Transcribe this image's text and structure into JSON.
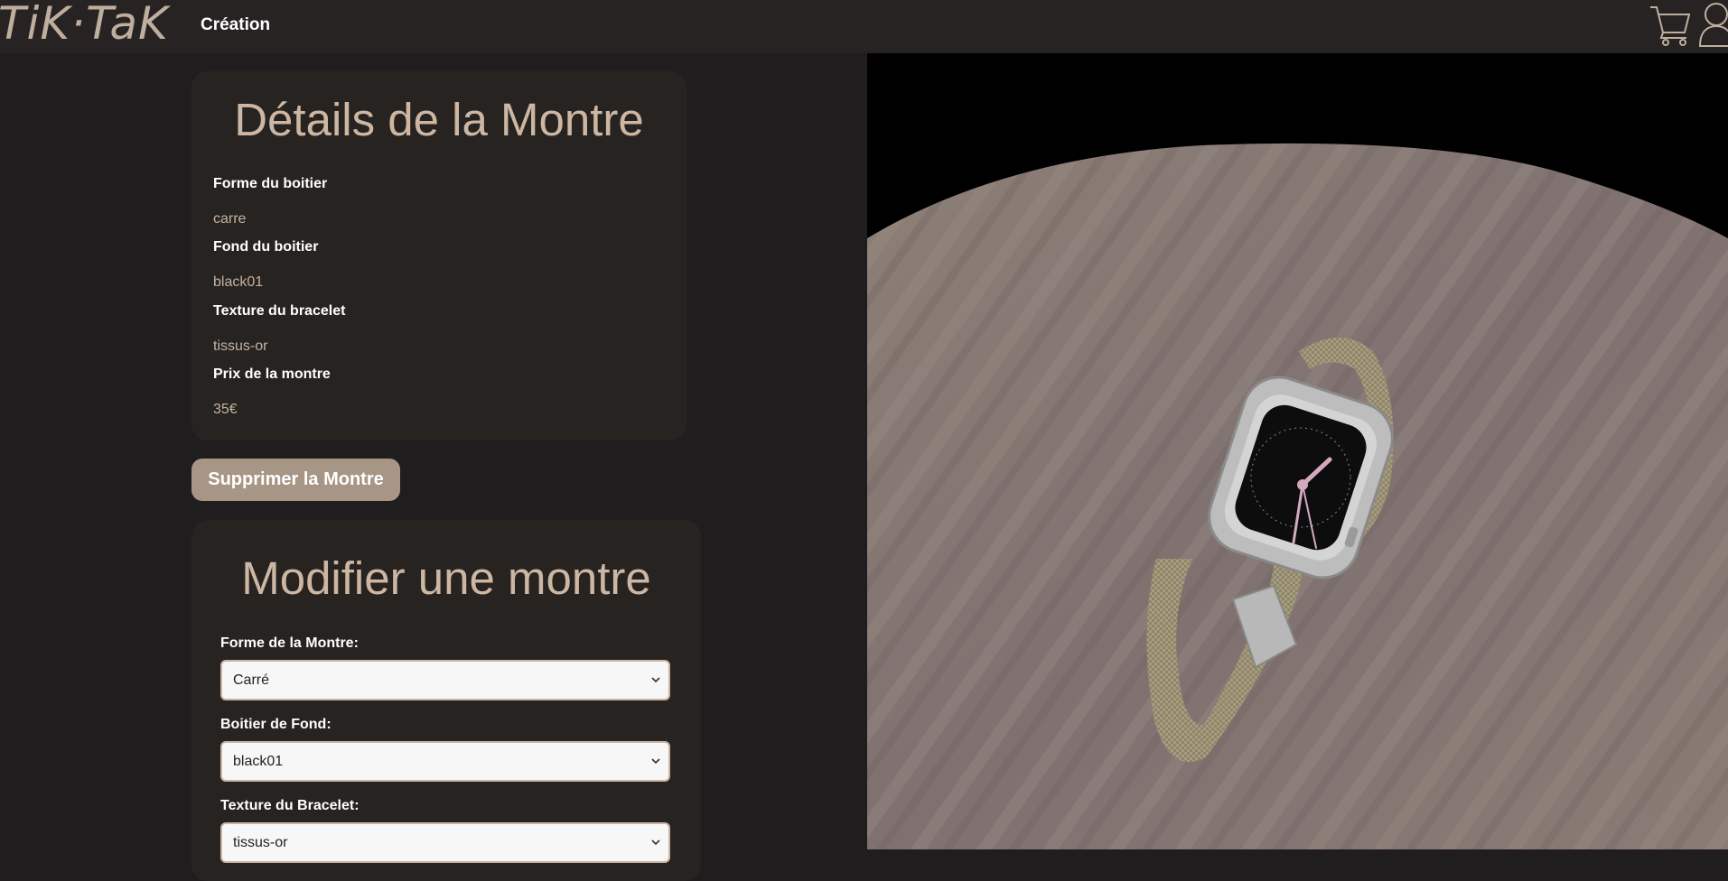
{
  "header": {
    "logo": "TiK·TaK",
    "nav_link": "Création",
    "cart_icon": "shopping-cart-icon",
    "user_icon": "user-icon"
  },
  "details": {
    "title": "Détails de la Montre",
    "items": [
      {
        "label": "Forme du boitier",
        "value": "carre"
      },
      {
        "label": "Fond du boitier",
        "value": "black01"
      },
      {
        "label": "Texture du bracelet",
        "value": "tissus-or"
      },
      {
        "label": "Prix de la montre",
        "value": "35€"
      }
    ]
  },
  "delete_button": "Supprimer la Montre",
  "edit_form": {
    "title": "Modifier une montre",
    "fields": [
      {
        "label": "Forme de la Montre:",
        "value": "Carré"
      },
      {
        "label": "Boitier de Fond:",
        "value": "black01"
      },
      {
        "label": "Texture du Bracelet:",
        "value": "tissus-or"
      }
    ]
  },
  "colors": {
    "header_bg": "#272323",
    "page_bg": "#1f1d1d",
    "card_bg": "#272321",
    "accent_text": "#cdb6a2",
    "button_bg": "#a79686",
    "viewport_bg": "#000000"
  }
}
